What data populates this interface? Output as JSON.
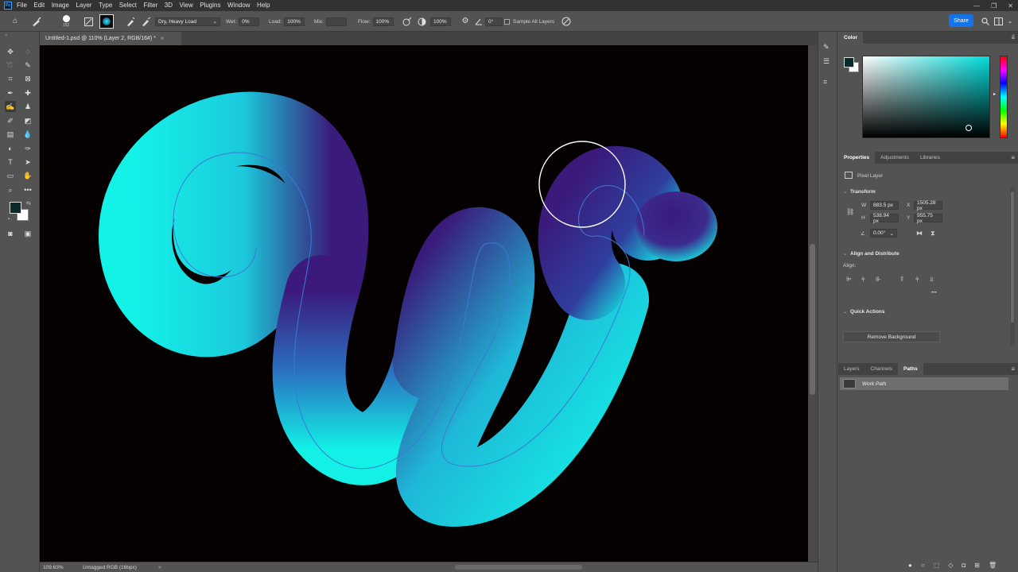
{
  "app": {
    "logo": "Ps"
  },
  "menu": [
    "File",
    "Edit",
    "Image",
    "Layer",
    "Type",
    "Select",
    "Filter",
    "3D",
    "View",
    "Plugins",
    "Window",
    "Help"
  ],
  "options": {
    "brush_size": "152",
    "brush_preset": "Dry, Heavy Load",
    "wet_label": "Wet:",
    "wet_value": "0%",
    "load_label": "Load:",
    "load_value": "100%",
    "mix_label": "Mix:",
    "mix_value": "",
    "flow_label": "Flow:",
    "flow_value": "100%",
    "smoothing_value": "100%",
    "angle_value": "0°",
    "sample_all_label": "Sample All Layers",
    "share_label": "Share"
  },
  "document": {
    "tab_title": "Untitled-1.psd @ 110% (Layer 2, RGB/16#) *",
    "zoom": "109.63%",
    "profile": "Untagged RGB (16bpc)",
    "status_arrow": ">"
  },
  "colors": {
    "foreground": "#0b2a2a",
    "background": "#ffffff",
    "stroke_light": "#12f1e6",
    "stroke_dark": "#3a1a7a",
    "path_line": "#3a7bd5",
    "accent": "#1473e6"
  },
  "color_panel": {
    "title": "Color"
  },
  "properties": {
    "tabs": [
      "Properties",
      "Adjustments",
      "Libraries"
    ],
    "layer_type": "Pixel Layer",
    "transform_title": "Transform",
    "w_label": "W",
    "w_value": "883.5 px",
    "x_label": "X",
    "x_value": "1505.28 px",
    "h_label": "H",
    "h_value": "538.94 px",
    "y_label": "Y",
    "y_value": "955.75 px",
    "angle_value": "0.00°",
    "align_title": "Align and Distribute",
    "align_label": "Align:",
    "quick_actions_title": "Quick Actions",
    "remove_bg_label": "Remove Background"
  },
  "layers_panel": {
    "tabs": [
      "Layers",
      "Channels",
      "Paths"
    ],
    "active_tab": "Paths",
    "paths": [
      {
        "name": "Work Path"
      }
    ]
  }
}
